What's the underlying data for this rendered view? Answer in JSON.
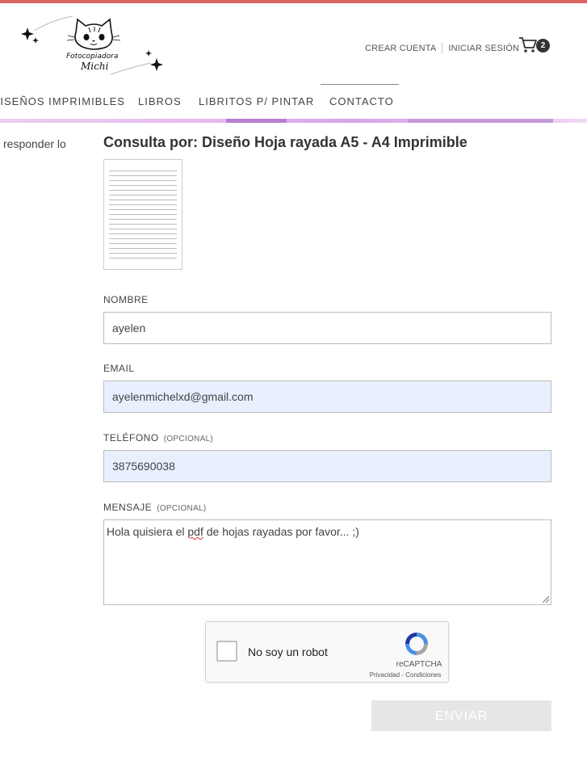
{
  "header": {
    "brand_line1": "Fotocopiadora",
    "brand_line2": "Michi",
    "account": {
      "create": "CREAR CUENTA",
      "login": "INICIAR SESIÓN"
    },
    "cart_count": "2"
  },
  "nav": {
    "items": [
      "DISEÑOS IMPRIMIBLES",
      "LIBROS",
      "LIBRITOS P/ PINTAR",
      "CONTACTO"
    ],
    "active": "CONTACTO"
  },
  "side_text": "responder lo",
  "form": {
    "title": "Consulta por: Diseño Hoja rayada A5 - A4 Imprimible",
    "nombre": {
      "label": "NOMBRE",
      "value": "ayelen"
    },
    "email": {
      "label": "EMAIL",
      "value": "ayelenmichelxd@gmail.com"
    },
    "telefono": {
      "label": "TELÉFONO",
      "optional": "(OPCIONAL)",
      "value": "3875690038"
    },
    "mensaje": {
      "label": "MENSAJE",
      "optional": "(OPCIONAL)",
      "value_before": "Hola quisiera el ",
      "value_misspelled": "pdf",
      "value_after": " de hojas rayadas por favor... ;)"
    },
    "captcha": {
      "text": "No soy un robot",
      "brand": "reCAPTCHA",
      "terms": "Privacidad - Condiciones"
    },
    "submit": "ENVIAR"
  },
  "colors": {
    "top_bar": "#d9665f",
    "autofill": "#e8f0fe",
    "submit_bg": "#e6e6e6"
  }
}
